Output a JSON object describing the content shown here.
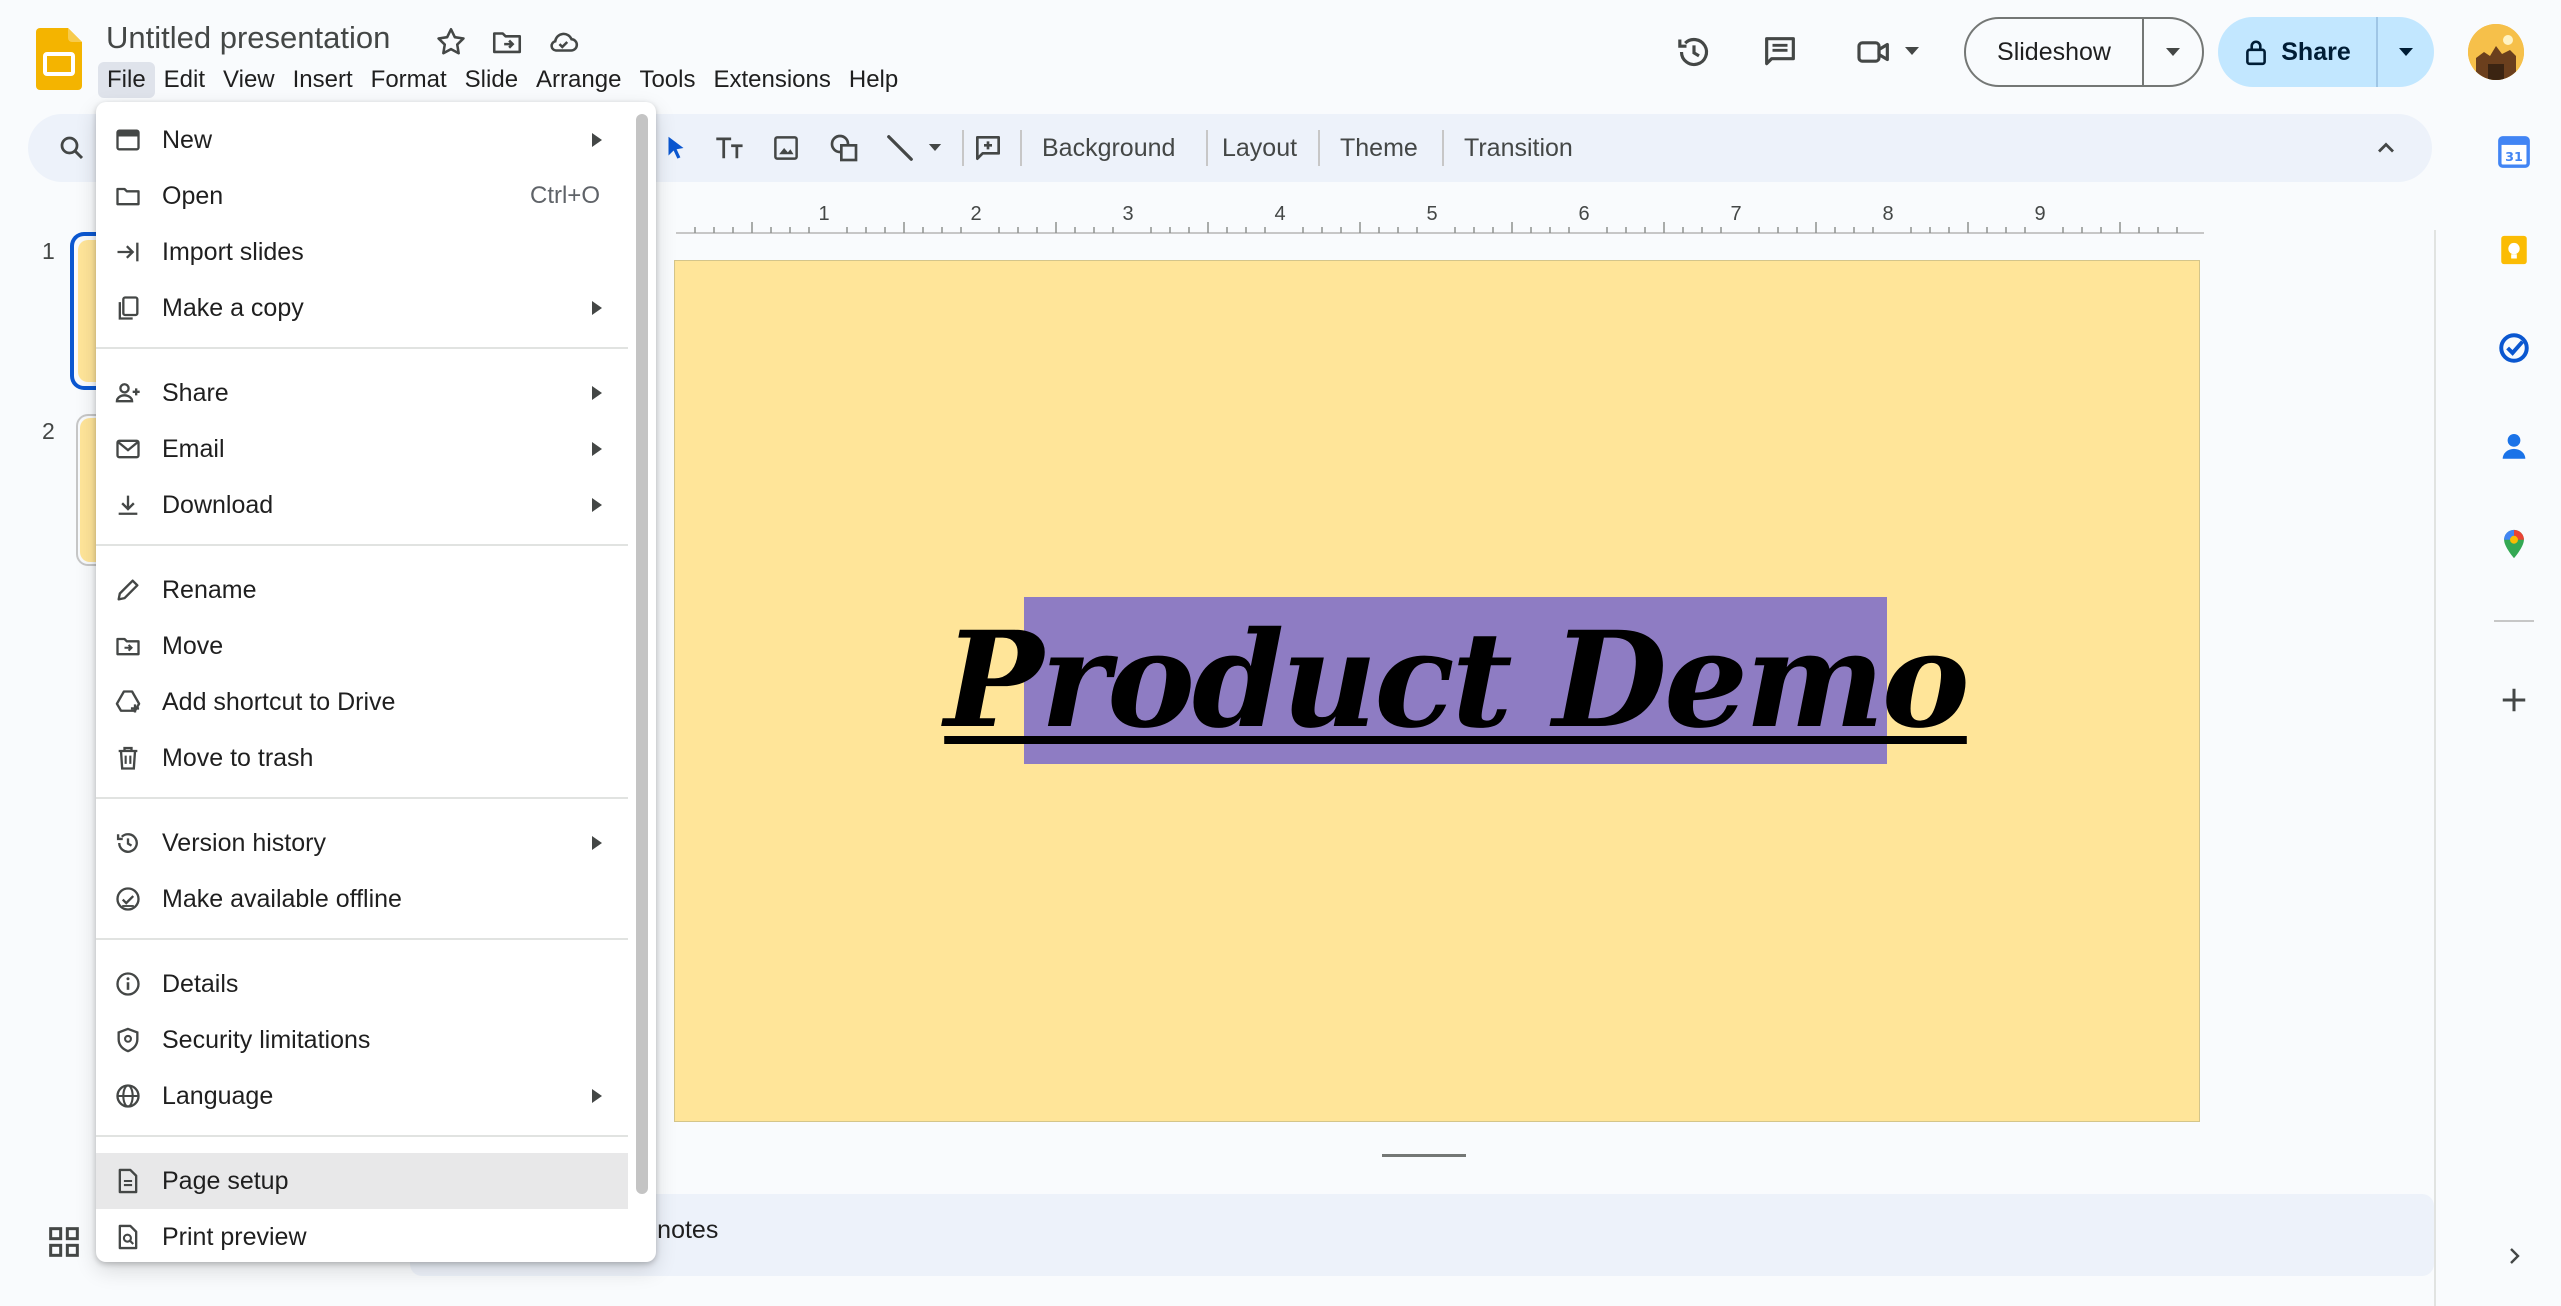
{
  "header": {
    "doc_title": "Untitled presentation",
    "menu": [
      "File",
      "Edit",
      "View",
      "Insert",
      "Format",
      "Slide",
      "Arrange",
      "Tools",
      "Extensions",
      "Help"
    ],
    "slideshow_label": "Slideshow",
    "share_label": "Share"
  },
  "toolbar": {
    "background_label": "Background",
    "layout_label": "Layout",
    "theme_label": "Theme",
    "transition_label": "Transition"
  },
  "filmstrip": {
    "slide_numbers": [
      "1",
      "2"
    ]
  },
  "ruler": {
    "labels": [
      "1",
      "2",
      "3",
      "4",
      "5",
      "6",
      "7",
      "8",
      "9"
    ]
  },
  "slide": {
    "title_text": "Product Demo"
  },
  "notes": {
    "visible_text": "er notes"
  },
  "file_menu": {
    "new": "New",
    "open": "Open",
    "open_shortcut": "Ctrl+O",
    "import_slides": "Import slides",
    "make_copy": "Make a copy",
    "share": "Share",
    "email": "Email",
    "download": "Download",
    "rename": "Rename",
    "move": "Move",
    "add_shortcut": "Add shortcut to Drive",
    "move_to_trash": "Move to trash",
    "version_history": "Version history",
    "offline": "Make available offline",
    "details": "Details",
    "security": "Security limitations",
    "language": "Language",
    "page_setup": "Page setup",
    "print_preview": "Print preview"
  },
  "colors": {
    "slide_background": "#ffe599",
    "title_box": "#8e7cc3",
    "share_button": "#c2e7ff",
    "toolbar_bg": "#edf2fa",
    "accent_blue": "#0b57d0"
  }
}
